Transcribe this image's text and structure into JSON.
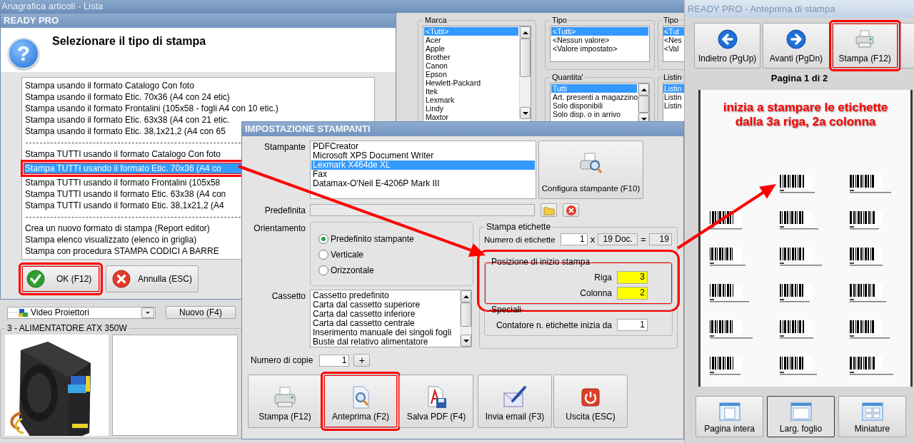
{
  "main_window": {
    "title": "Anagrafica articoli  - Lista",
    "filters": [
      {
        "label": "Marca",
        "scrollable": true,
        "items": [
          {
            "text": "<Tutti>",
            "selected": true
          },
          {
            "text": "Acer",
            "selected": false
          },
          {
            "text": "Apple",
            "selected": false
          },
          {
            "text": "Brother",
            "selected": false
          },
          {
            "text": "Canon",
            "selected": false
          },
          {
            "text": "Epson",
            "selected": false
          },
          {
            "text": "Hewlett-Packard",
            "selected": false
          },
          {
            "text": "Itek",
            "selected": false
          },
          {
            "text": "Lexmark",
            "selected": false
          },
          {
            "text": "Lindy",
            "selected": false
          },
          {
            "text": "Maxtor",
            "selected": false
          }
        ]
      },
      {
        "label": "Tipo",
        "scrollable": false,
        "items": [
          {
            "text": "<Tutti>",
            "selected": true
          },
          {
            "text": "<Nessun valore>",
            "selected": false
          },
          {
            "text": "<Valore impostato>",
            "selected": false
          }
        ]
      },
      {
        "label": "Tipo",
        "scrollable": false,
        "items": [
          {
            "text": "<Tut",
            "selected": true
          },
          {
            "text": "<Nes",
            "selected": false
          },
          {
            "text": "<Val",
            "selected": false
          }
        ]
      },
      {
        "label": "Quantita'",
        "scrollable": true,
        "items": [
          {
            "text": "Tutti",
            "selected": true
          },
          {
            "text": "Art. presenti a magazzino",
            "selected": false
          },
          {
            "text": "Solo disponibili",
            "selected": false
          },
          {
            "text": "Solo disp. o in arrivo",
            "selected": false
          }
        ]
      },
      {
        "label": "Listin",
        "scrollable": false,
        "items": [
          {
            "text": "Listin",
            "selected": true
          },
          {
            "text": "Listin",
            "selected": false
          },
          {
            "text": "Listin",
            "selected": false
          }
        ]
      }
    ],
    "category_picker": {
      "value": "Video Proiettori"
    },
    "new_button": "Nuovo (F4)",
    "product": {
      "title": "3 - ALIMENTATORE ATX 350W"
    }
  },
  "print_type_dialog": {
    "title": "READY PRO",
    "help_glyph": "?",
    "heading": "Selezionare il tipo di stampa",
    "options": [
      {
        "kind": "option",
        "text": "Stampa usando il formato Catalogo Con foto",
        "selected": false,
        "highlighted": false
      },
      {
        "kind": "option",
        "text": "Stampa usando il formato Etic. 70x36 (A4 con 24 etic)",
        "selected": false,
        "highlighted": false
      },
      {
        "kind": "option",
        "text": "Stampa usando il formato Frontalini (105x58 - fogli A4 con 10 etic.)",
        "selected": false,
        "highlighted": false
      },
      {
        "kind": "option",
        "text": "Stampa usando il formato Etic. 63x38 (A4 con 21 etic.",
        "selected": false,
        "highlighted": false
      },
      {
        "kind": "option",
        "text": "Stampa usando il formato Etic. 38,1x21,2 (A4 con 65",
        "selected": false,
        "highlighted": false
      },
      {
        "kind": "separator"
      },
      {
        "kind": "option",
        "text": "Stampa TUTTI usando il formato Catalogo Con foto",
        "selected": false,
        "highlighted": false
      },
      {
        "kind": "option",
        "text": "Stampa TUTTI usando il formato Etic. 70x36 (A4 co",
        "selected": true,
        "highlighted": true
      },
      {
        "kind": "option",
        "text": "Stampa TUTTI usando il formato Frontalini (105x58",
        "selected": false,
        "highlighted": false
      },
      {
        "kind": "option",
        "text": "Stampa TUTTI usando il formato Etic. 63x38 (A4 con",
        "selected": false,
        "highlighted": false
      },
      {
        "kind": "option",
        "text": "Stampa TUTTI usando il formato Etic. 38,1x21,2 (A4",
        "selected": false,
        "highlighted": false
      },
      {
        "kind": "separator"
      },
      {
        "kind": "option",
        "text": "Crea un nuovo formato di stampa (Report editor)",
        "selected": false,
        "highlighted": false
      },
      {
        "kind": "option",
        "text": "Stampa elenco visualizzato (elenco in griglia)",
        "selected": false,
        "highlighted": false
      },
      {
        "kind": "option",
        "text": "Stampa con procedura STAMPA CODICI A BARRE",
        "selected": false,
        "highlighted": false
      }
    ],
    "buttons": [
      {
        "kind": "ok",
        "label": "OK (F12)",
        "highlighted": true
      },
      {
        "kind": "cancel",
        "label": "Annulla (ESC)",
        "highlighted": false
      }
    ]
  },
  "printer_dialog": {
    "title": "IMPOSTAZIONE STAMPANTI",
    "printer": {
      "label": "Stampante",
      "items": [
        {
          "text": "PDFCreator",
          "selected": false
        },
        {
          "text": "Microsoft XPS Document Writer",
          "selected": false
        },
        {
          "text": "Lexmark X464de XL",
          "selected": true
        },
        {
          "text": "Fax",
          "selected": false
        },
        {
          "text": "Datamax-O'Neil E-4206P Mark III",
          "selected": false
        }
      ]
    },
    "configure_button": "Configura stampante (F10)",
    "default_printer": {
      "label": "Predefinita"
    },
    "orientation": {
      "label": "Orientamento",
      "options": [
        {
          "text": "Predefinito stampante",
          "selected": true
        },
        {
          "text": "Verticale",
          "selected": false
        },
        {
          "text": "Orizzontale",
          "selected": false
        }
      ]
    },
    "tray": {
      "label": "Cassetto",
      "items": [
        "Cassetto predefinito",
        "Carta dal cassetto superiore",
        "Carta dal cassetto inferiore",
        "Carta dal cassetto centrale",
        "Inserimento manuale dei singoli fogli",
        "Buste dal relativo alimentatore"
      ]
    },
    "label_print": {
      "title": "Stampa etichette",
      "count_label": "Numero di etichette",
      "count": "1",
      "times": "x",
      "documents": "19 Doc.",
      "equals": "=",
      "total": "19",
      "start_position": {
        "title": "Posizione di inizio stampa",
        "highlighted": true,
        "row_label": "Riga",
        "row": "3",
        "column_label": "Colonna",
        "column": "2"
      },
      "special": {
        "title": "Speciali",
        "counter_label": "Contatore n. etichette inizia da",
        "counter": "1"
      }
    },
    "copies": {
      "label": "Numero di copie",
      "value": "1",
      "plus": "+"
    },
    "actions": [
      {
        "kind": "print",
        "label": "Stampa (F12)",
        "highlighted": false
      },
      {
        "kind": "preview",
        "label": "Anteprima (F2)",
        "highlighted": true
      },
      {
        "kind": "pdf",
        "label": "Salva PDF (F4)",
        "highlighted": false
      },
      {
        "kind": "email",
        "label": "Invia email (F3)",
        "highlighted": false
      },
      {
        "kind": "exit",
        "label": "Uscita (ESC)",
        "highlighted": false
      }
    ]
  },
  "preview_window": {
    "title": "READY PRO - Anteprima di stampa",
    "toolbar": [
      {
        "kind": "back",
        "label": "Indietro (PgUp)",
        "highlighted": false
      },
      {
        "kind": "forward",
        "label": "Avanti (PgDn)",
        "highlighted": false
      },
      {
        "kind": "print",
        "label": "Stampa (F12)",
        "highlighted": true
      }
    ],
    "page_label": "Pagina 1 di 2",
    "note": "inizia a stampare le etichette\ndalla 3a riga, 2a colonna",
    "label_slots": [
      {
        "filled": false
      },
      {
        "filled": true
      },
      {
        "filled": true
      },
      {
        "filled": true
      },
      {
        "filled": true
      },
      {
        "filled": true
      },
      {
        "filled": true
      },
      {
        "filled": true
      },
      {
        "filled": true
      },
      {
        "filled": true
      },
      {
        "filled": true
      },
      {
        "filled": true
      },
      {
        "filled": true
      },
      {
        "filled": true
      },
      {
        "filled": true
      },
      {
        "filled": true
      },
      {
        "filled": true
      },
      {
        "filled": true
      }
    ],
    "views": [
      {
        "kind": "full",
        "label": "Pagina intera",
        "selected": false
      },
      {
        "kind": "width",
        "label": "Larg. foglio",
        "selected": true
      },
      {
        "kind": "thumbs",
        "label": "Miniature",
        "selected": false
      }
    ]
  }
}
